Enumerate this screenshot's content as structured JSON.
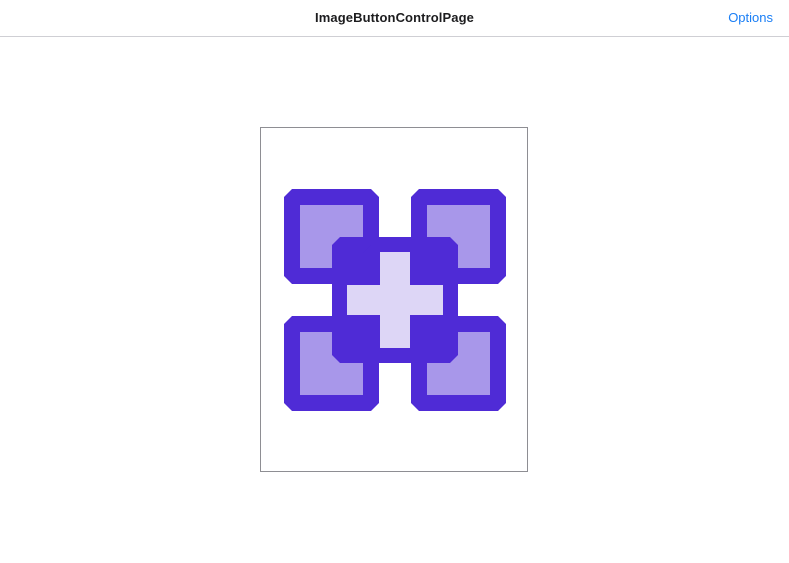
{
  "navbar": {
    "title": "ImageButtonControlPage",
    "options_label": "Options"
  },
  "image_button": {
    "icon": "plus-tiles-icon",
    "colors": {
      "dark": "#4f2bd6",
      "medium": "#a897ea",
      "light": "#ddd6f6",
      "border": "#8e8e93"
    }
  },
  "colors": {
    "accent": "#1a7ef5",
    "title": "#1c1c1e",
    "divider": "#cfcfd4"
  }
}
